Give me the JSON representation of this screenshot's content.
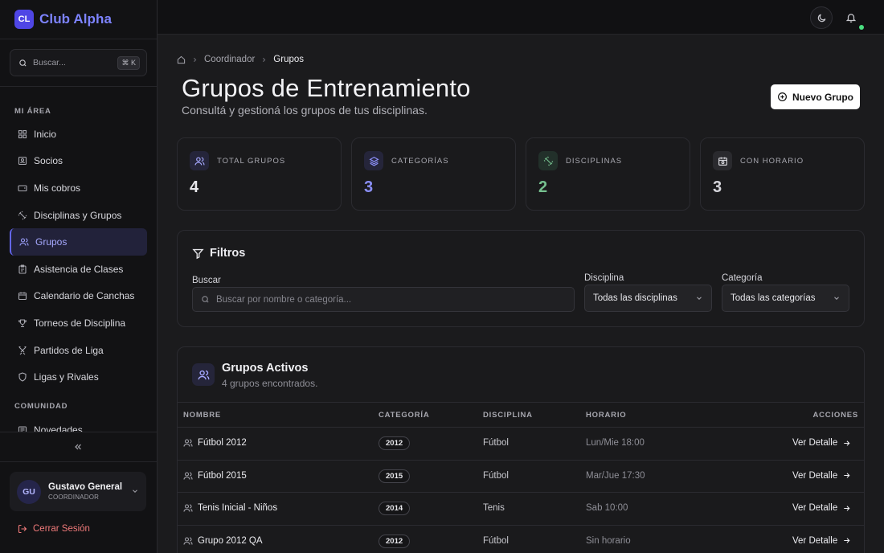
{
  "brand": {
    "logo": "CL",
    "name": "Club Alpha"
  },
  "sidebar": {
    "search_placeholder": "Buscar...",
    "search_shortcut": "⌘ K",
    "section_mi_area": "MI ÁREA",
    "items": [
      {
        "label": "Inicio",
        "icon": "grid-icon"
      },
      {
        "label": "Socios",
        "icon": "id-card-icon"
      },
      {
        "label": "Mis cobros",
        "icon": "wallet-icon"
      },
      {
        "label": "Disciplinas y Grupos",
        "icon": "dumbbell-icon"
      },
      {
        "label": "Grupos",
        "icon": "users-icon"
      },
      {
        "label": "Asistencia de Clases",
        "icon": "clipboard-icon"
      },
      {
        "label": "Calendario de Canchas",
        "icon": "calendar-icon"
      },
      {
        "label": "Torneos de Disciplina",
        "icon": "trophy-icon"
      },
      {
        "label": "Partidos de Liga",
        "icon": "swords-icon"
      },
      {
        "label": "Ligas y Rivales",
        "icon": "shield-icon"
      }
    ],
    "section_comunidad": "COMUNIDAD",
    "community_items": [
      {
        "label": "Novedades",
        "icon": "newspaper-icon"
      }
    ],
    "user": {
      "initials": "GU",
      "name": "Gustavo General",
      "role": "COORDINADOR"
    },
    "logout_label": "Cerrar Sesión"
  },
  "breadcrumb": {
    "parent": "Coordinador",
    "current": "Grupos"
  },
  "page": {
    "title": "Grupos de Entrenamiento",
    "subtitle": "Consultá y gestioná los grupos de tus disciplinas.",
    "new_button": "Nuevo Grupo"
  },
  "stats": [
    {
      "label": "TOTAL GRUPOS",
      "value": "4",
      "color": "#e8e8ec",
      "icon": "users-icon"
    },
    {
      "label": "CATEGORÍAS",
      "value": "3",
      "color": "#8b8ff8",
      "icon": "layers-icon"
    },
    {
      "label": "DISCIPLINAS",
      "value": "2",
      "color": "#76c08f",
      "icon": "dumbbell-icon"
    },
    {
      "label": "CON HORARIO",
      "value": "3",
      "color": "#d6d6dc",
      "icon": "calendar-clock-icon"
    }
  ],
  "filters": {
    "title": "Filtros",
    "search_label": "Buscar",
    "search_placeholder": "Buscar por nombre o categoría...",
    "discipline_label": "Disciplina",
    "discipline_value": "Todas las disciplinas",
    "category_label": "Categoría",
    "category_value": "Todas las categorías"
  },
  "groups": {
    "title": "Grupos Activos",
    "subtitle": "4 grupos encontrados.",
    "columns": [
      "NOMBRE",
      "CATEGORÍA",
      "DISCIPLINA",
      "HORARIO",
      "ACCIONES"
    ],
    "rows": [
      {
        "name": "Fútbol 2012",
        "category": "2012",
        "discipline": "Fútbol",
        "schedule": "Lun/Mie 18:00",
        "action": "Ver Detalle"
      },
      {
        "name": "Fútbol 2015",
        "category": "2015",
        "discipline": "Fútbol",
        "schedule": "Mar/Jue 17:30",
        "action": "Ver Detalle"
      },
      {
        "name": "Tenis Inicial - Niños",
        "category": "2014",
        "discipline": "Tenis",
        "schedule": "Sab 10:00",
        "action": "Ver Detalle"
      },
      {
        "name": "Grupo 2012 QA",
        "category": "2012",
        "discipline": "Fútbol",
        "schedule": "Sin horario",
        "action": "Ver Detalle"
      }
    ]
  }
}
